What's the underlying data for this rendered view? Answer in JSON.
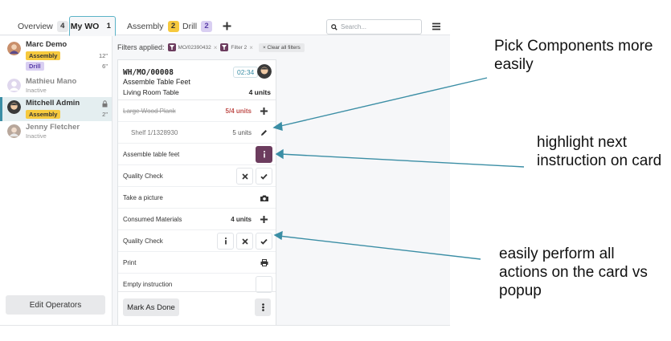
{
  "tabs": [
    {
      "label": "Overview",
      "count": "4"
    },
    {
      "label": "My WO",
      "count": "1"
    },
    {
      "label": "Assembly",
      "count": "2"
    },
    {
      "label": "Drill",
      "count": "2"
    }
  ],
  "add_tab_icon": "plus-icon",
  "search": {
    "placeholder": "Search..."
  },
  "menu_icon": "hamburger-icon",
  "operators": [
    {
      "name": "Marc Demo",
      "badges": [
        {
          "label": "Assembly",
          "time": "12\""
        },
        {
          "label": "Drill",
          "time": "6\""
        }
      ]
    },
    {
      "name": "Mathieu Mano",
      "status": "Inactive"
    },
    {
      "name": "Mitchell Admin",
      "badges": [
        {
          "label": "Assembly",
          "time": "2\""
        }
      ],
      "lock_icon": "lock-icon"
    },
    {
      "name": "Jenny Fletcher",
      "status": "Inactive"
    }
  ],
  "edit_operators_label": "Edit Operators",
  "filters": {
    "label": "Filters applied:",
    "chips": [
      "MO/02390432",
      "Filter 2"
    ],
    "clear_label": "× Clear all filters"
  },
  "card": {
    "reference": "WH/MO/00008",
    "operation": "Assemble Table Feet",
    "product": "Living Room Table",
    "quantity": "4 units",
    "timer": "02:34",
    "rows": [
      {
        "label": "Large Wood Plank",
        "value": "5/4 units"
      },
      {
        "label": "Shelf 1/1328930",
        "value": "5 units"
      },
      {
        "label": "Assemble table feet"
      },
      {
        "label": "Quality Check"
      },
      {
        "label": "Take a picture"
      },
      {
        "label": "Consumed Materials",
        "value": "4 units"
      },
      {
        "label": "Quality Check"
      },
      {
        "label": "Print"
      },
      {
        "label": "Empty instruction"
      }
    ],
    "mark_done_label": "Mark As Done"
  },
  "annotations": [
    "Pick Components more easily",
    "highlight next instruction on card",
    "easily perform all actions on the card vs popup"
  ],
  "colors": {
    "accent_teal": "#3b8ea5",
    "primary_purple": "#6c3c5e",
    "assembly_badge": "#f6c93e",
    "drill_badge": "#d9cff2",
    "overconsumed_red": "#c0504d"
  }
}
